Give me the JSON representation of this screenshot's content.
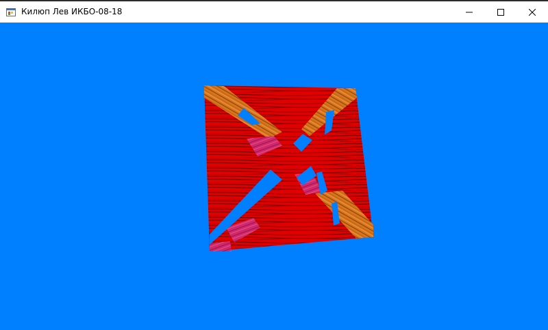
{
  "window": {
    "title": "Килюп Лев ИКБО-08-18",
    "icons": {
      "app": "app-icon",
      "minimize": "minimize-icon",
      "maximize": "maximize-icon",
      "close": "close-icon"
    }
  },
  "viewport": {
    "background_color": "#0080ff",
    "scene": "textured-cube",
    "texture_colors": {
      "red_wood": "#e00000",
      "dark_grain": "#8a0000",
      "orange_wood": "#d9761c",
      "pink_wood": "#d0286a"
    }
  }
}
